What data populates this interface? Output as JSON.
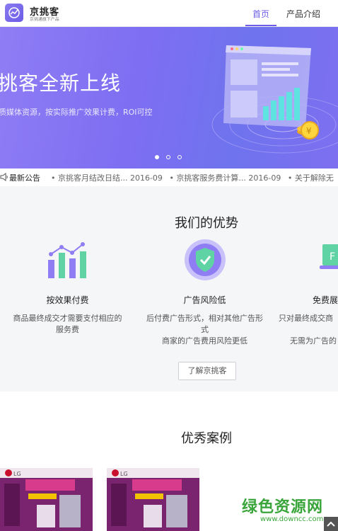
{
  "header": {
    "brand_name": "京挑客",
    "brand_sub": "京挑通旗下产品",
    "nav": [
      {
        "label": "首页",
        "active": true
      },
      {
        "label": "产品介绍",
        "active": false
      }
    ],
    "accent": "#6c5ce7"
  },
  "banner": {
    "title": "挑客全新上线",
    "subtitle": "质媒体资源，按实际推广效果计费，ROI可控",
    "dots": 3,
    "active_dot": 1
  },
  "notice": {
    "label": "最新公告",
    "items": [
      "• 京挑客月结改日结... 2016-09",
      "• 京挑客服务费计算... 2016-09",
      "• 关于解除无"
    ]
  },
  "advantages": {
    "title": "我们的优势",
    "cards": [
      {
        "icon": "bar-chart-icon",
        "name": "按效果付费",
        "desc_lines": [
          "商品最终成交才需要支付相应的",
          "服务费"
        ]
      },
      {
        "icon": "shield-check-icon",
        "name": "广告风险低",
        "desc_lines": [
          "后付费广告形式，相对其他广告形",
          "式",
          "商家的广告费用风险更低"
        ]
      },
      {
        "icon": "monitor-icon",
        "name": "免费展",
        "desc_lines": [
          "只对最终成交商",
          "",
          "无需为广告的"
        ]
      }
    ],
    "more_button": "了解京挑客"
  },
  "cases": {
    "title": "优秀案例",
    "images": [
      {
        "label": "LG case poster"
      },
      {
        "label": "LG case poster"
      }
    ]
  },
  "watermark": {
    "main": "绿色资源网",
    "url": "www.downcc.com"
  }
}
